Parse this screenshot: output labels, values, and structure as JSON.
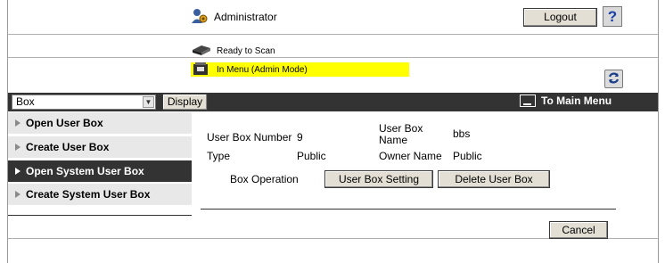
{
  "header": {
    "user_label": "Administrator",
    "logout_label": "Logout",
    "help_label": "?",
    "status_ready": "Ready to Scan",
    "status_mode": "In Menu (Admin Mode)"
  },
  "navbar": {
    "select_value": "Box",
    "display_label": "Display",
    "main_menu_label": "To Main Menu"
  },
  "sidebar": {
    "items": [
      {
        "label": "Open User Box",
        "active": false
      },
      {
        "label": "Create User Box",
        "active": false
      },
      {
        "label": "Open System User Box",
        "active": true
      },
      {
        "label": "Create System User Box",
        "active": false
      }
    ]
  },
  "details": {
    "box_number_label": "User Box Number",
    "box_number_value": "9",
    "box_name_label_1": "User Box",
    "box_name_label_2": "Name",
    "box_name_value": "bbs",
    "type_label": "Type",
    "type_value": "Public",
    "owner_label": "Owner Name",
    "owner_value": "Public",
    "operation_label": "Box Operation",
    "setting_button": "User Box Setting",
    "delete_button": "Delete User Box"
  },
  "footer": {
    "cancel_label": "Cancel"
  },
  "colors": {
    "navbar_bg": "#333333",
    "status_highlight": "#ffff00",
    "button_face": "#e4dfd4",
    "sidebar_bg": "#e8e8e8"
  }
}
